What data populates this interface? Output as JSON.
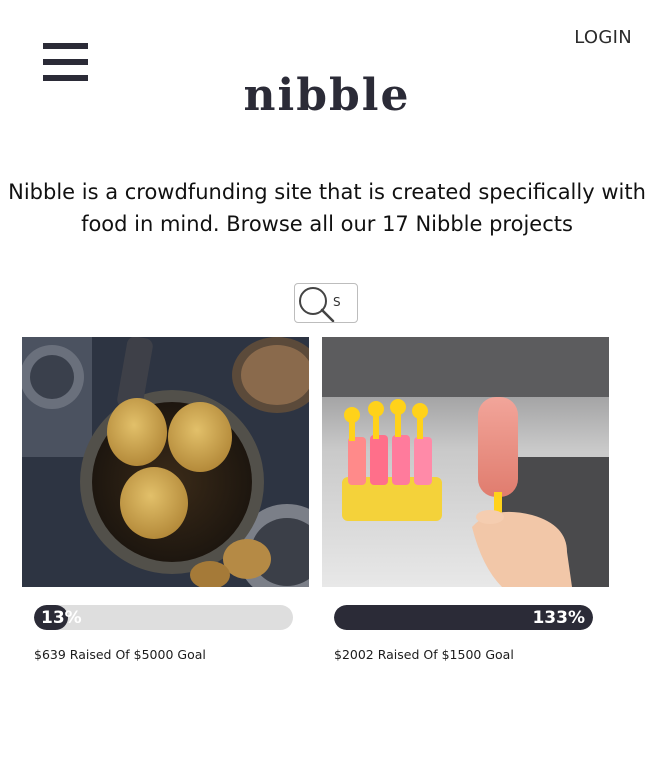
{
  "header": {
    "login_label": "LOGIN",
    "logo_text": "nibble"
  },
  "intro": {
    "text": "Nibble is a crowdfunding site that is created specifically with food in mind. Browse all our 17 Nibble projects"
  },
  "search": {
    "value": "S",
    "icon": "search-icon"
  },
  "projects": [
    {
      "image": "fried-puri-in-pan-photo",
      "progress_label": "13%",
      "progress_percent": 13,
      "raised_text": "$639 Raised Of $5000 Goal"
    },
    {
      "image": "popsicle-in-hand-photo",
      "progress_label": "133%",
      "progress_percent": 133,
      "raised_text": "$2002 Raised Of $1500 Goal"
    }
  ],
  "colors": {
    "brand_dark": "#2b2b37",
    "progress_track": "#dedede"
  }
}
